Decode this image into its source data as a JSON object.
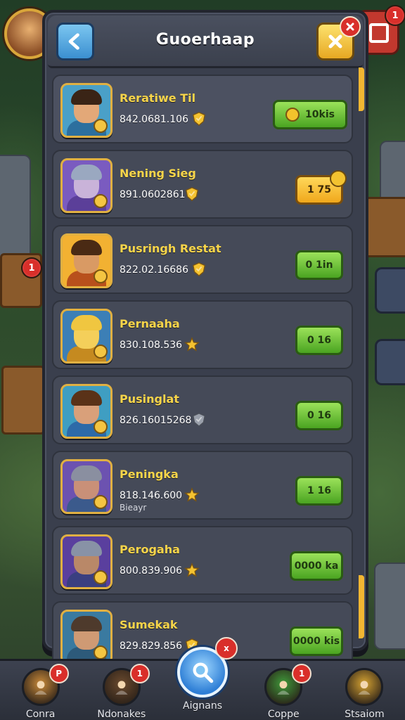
{
  "panel": {
    "title": "Guoerhaap"
  },
  "players": [
    {
      "name": "Reratiwe Til",
      "score": "842.0681.106",
      "rank_icon": "shield-gold-icon",
      "button": {
        "label": "10kis",
        "style": "green"
      }
    },
    {
      "name": "Nening Sieg",
      "score": "891.0602861",
      "rank_icon": "shield-gold-icon",
      "button": {
        "label": "1 75",
        "style": "yellow"
      }
    },
    {
      "name": "Pusringh Restat",
      "score": "822.02.16686",
      "rank_icon": "shield-gold-icon",
      "button": {
        "label": "0 1in",
        "style": "green"
      }
    },
    {
      "name": "Pernaaha",
      "score": "830.108.536",
      "rank_icon": "star-gold-icon",
      "button": {
        "label": "0 16",
        "style": "green"
      }
    },
    {
      "name": "Pusinglat",
      "score": "826.16015268",
      "rank_icon": "shield-silver-icon",
      "button": {
        "label": "0 16",
        "style": "green"
      }
    },
    {
      "name": "Peningka",
      "score": "818.146.600",
      "note": "Bieayr",
      "rank_icon": "star-gold-icon",
      "button": {
        "label": "1 16",
        "style": "green"
      }
    },
    {
      "name": "Perogaha",
      "score": "800.839.906",
      "rank_icon": "star-gold-icon",
      "button": {
        "label": "0000 ka",
        "style": "green"
      }
    },
    {
      "name": "Sumekak",
      "score": "829.829.856",
      "rank_icon": "shield-gold-icon",
      "button": {
        "label": "0000 kis",
        "style": "green"
      }
    }
  ],
  "nav": [
    {
      "label": "Conra",
      "icon": "hero-icon",
      "badge": "P",
      "color": "#c98a3a"
    },
    {
      "label": "Ndonakes",
      "icon": "warrior-icon",
      "badge": "1",
      "color": "#6b4a2e"
    },
    {
      "label": "Aignans",
      "icon": "search-icon",
      "badge": "x",
      "color": "#2f7fd6",
      "active": true
    },
    {
      "label": "Coppe",
      "icon": "anvil-icon",
      "badge": "1",
      "color": "#3f9a3a"
    },
    {
      "label": "Stsaiom",
      "icon": "fist-icon",
      "badge": "",
      "color": "#d6a332"
    }
  ],
  "colors": {
    "accent": "#f7d54a",
    "button_green": "#4aa421",
    "button_yellow": "#f0a81c",
    "badge_red": "#d92f2a"
  }
}
